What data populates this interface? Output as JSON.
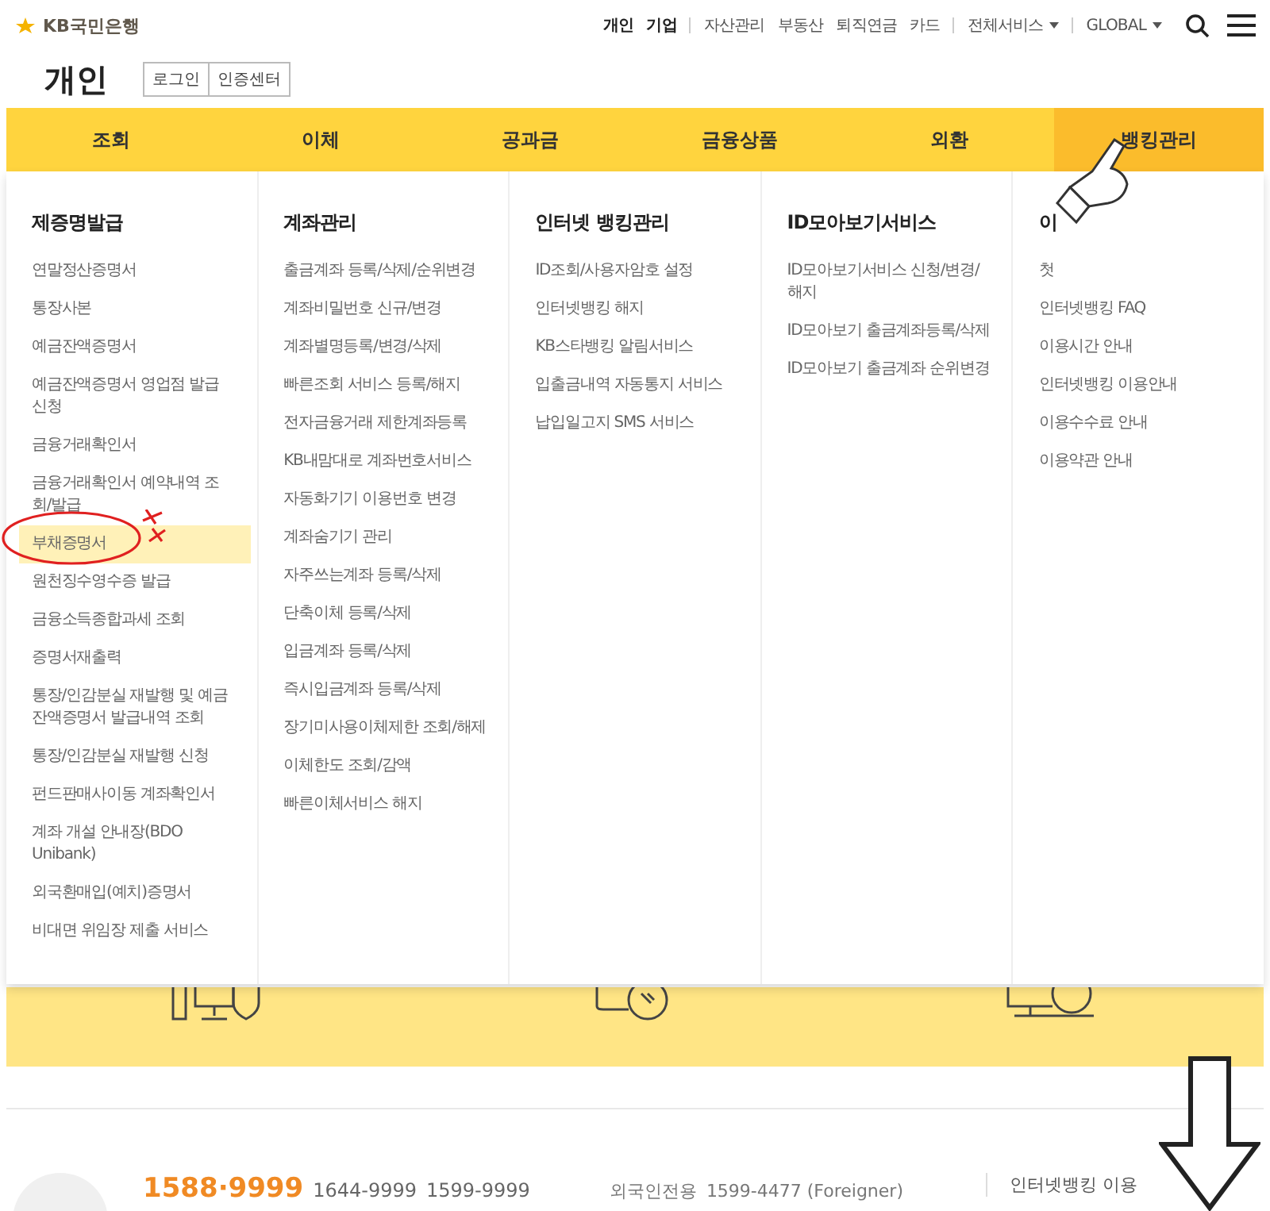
{
  "brand": {
    "name": "KB국민은행"
  },
  "top_nav": [
    {
      "kind": "primary",
      "items": [
        "개인",
        "기업"
      ]
    },
    {
      "kind": "plain",
      "items": [
        "자산관리",
        "부동산",
        "퇴직연금",
        "카드"
      ]
    },
    {
      "kind": "dropdown",
      "items": [
        "전체서비스"
      ]
    },
    {
      "kind": "dropdown",
      "items": [
        "GLOBAL"
      ]
    }
  ],
  "section_title": "개인",
  "header_buttons": [
    "로그인",
    "인증센터"
  ],
  "tabs": [
    {
      "label": "조회",
      "selected": false
    },
    {
      "label": "이체",
      "selected": false
    },
    {
      "label": "공과금",
      "selected": false
    },
    {
      "label": "금융상품",
      "selected": false
    },
    {
      "label": "외환",
      "selected": false
    },
    {
      "label": "뱅킹관리",
      "selected": true
    }
  ],
  "menu_columns": [
    {
      "heading": "제증명발급",
      "items": [
        {
          "label": "연말정산증명서",
          "selected": false
        },
        {
          "label": "통장사본",
          "selected": false
        },
        {
          "label": "예금잔액증명서",
          "selected": false
        },
        {
          "label": "예금잔액증명서 영업점 발급 신청",
          "selected": false
        },
        {
          "label": "금융거래확인서",
          "selected": false
        },
        {
          "label": "금융거래확인서 예약내역 조회/발급",
          "selected": false
        },
        {
          "label": "부채증명서",
          "selected": true
        },
        {
          "label": "원천징수영수증 발급",
          "selected": false
        },
        {
          "label": "금융소득종합과세 조회",
          "selected": false
        },
        {
          "label": "증명서재출력",
          "selected": false
        },
        {
          "label": "통장/인감분실 재발행 및 예금잔액증명서 발급내역 조회",
          "selected": false
        },
        {
          "label": "통장/인감분실 재발행 신청",
          "selected": false
        },
        {
          "label": "펀드판매사이동 계좌확인서",
          "selected": false
        },
        {
          "label": "계좌 개설 안내장(BDO Unibank)",
          "selected": false
        },
        {
          "label": "외국환매입(예치)증명서",
          "selected": false
        },
        {
          "label": "비대면 위임장 제출 서비스",
          "selected": false
        }
      ]
    },
    {
      "heading": "계좌관리",
      "items": [
        {
          "label": "출금계좌 등록/삭제/순위변경",
          "selected": false
        },
        {
          "label": "계좌비밀번호 신규/변경",
          "selected": false
        },
        {
          "label": "계좌별명등록/변경/삭제",
          "selected": false
        },
        {
          "label": "빠른조회 서비스 등록/해지",
          "selected": false
        },
        {
          "label": "전자금융거래 제한계좌등록",
          "selected": false
        },
        {
          "label": "KB내맘대로 계좌번호서비스",
          "selected": false
        },
        {
          "label": "자동화기기 이용번호 변경",
          "selected": false
        },
        {
          "label": "계좌숨기기 관리",
          "selected": false
        },
        {
          "label": "자주쓰는계좌 등록/삭제",
          "selected": false
        },
        {
          "label": "단축이체 등록/삭제",
          "selected": false
        },
        {
          "label": "입금계좌 등록/삭제",
          "selected": false
        },
        {
          "label": "즉시입금계좌 등록/삭제",
          "selected": false
        },
        {
          "label": "장기미사용이체제한 조회/해제",
          "selected": false
        },
        {
          "label": "이체한도 조회/감액",
          "selected": false
        },
        {
          "label": "빠른이체서비스 해지",
          "selected": false
        }
      ]
    },
    {
      "heading": "인터넷 뱅킹관리",
      "items": [
        {
          "label": "ID조회/사용자암호 설정",
          "selected": false
        },
        {
          "label": "인터넷뱅킹 해지",
          "selected": false
        },
        {
          "label": "KB스타뱅킹 알림서비스",
          "selected": false
        },
        {
          "label": "입출금내역 자동통지 서비스",
          "selected": false
        },
        {
          "label": "납입일고지 SMS 서비스",
          "selected": false
        }
      ]
    },
    {
      "heading": "ID모아보기서비스",
      "items": [
        {
          "label": "ID모아보기서비스 신청/변경/해지",
          "selected": false
        },
        {
          "label": "ID모아보기 출금계좌등록/삭제",
          "selected": false
        },
        {
          "label": "ID모아보기 출금계좌 순위변경",
          "selected": false
        }
      ]
    },
    {
      "heading": "이",
      "items": [
        {
          "label": "첫",
          "selected": false
        },
        {
          "label": "인터넷뱅킹 FAQ",
          "selected": false
        },
        {
          "label": "이용시간 안내",
          "selected": false
        },
        {
          "label": "인터넷뱅킹 이용안내",
          "selected": false
        },
        {
          "label": "이용수수료 안내",
          "selected": false
        },
        {
          "label": "이용약관 안내",
          "selected": false
        }
      ]
    }
  ],
  "footer": {
    "main_number": "1588·9999",
    "numbers": [
      "1644-9999",
      "1599-9999"
    ],
    "foreign_label": "외국인전용",
    "foreign_number": "1599-4477 (Foreigner)",
    "link": "인터넷뱅킹 이용"
  }
}
